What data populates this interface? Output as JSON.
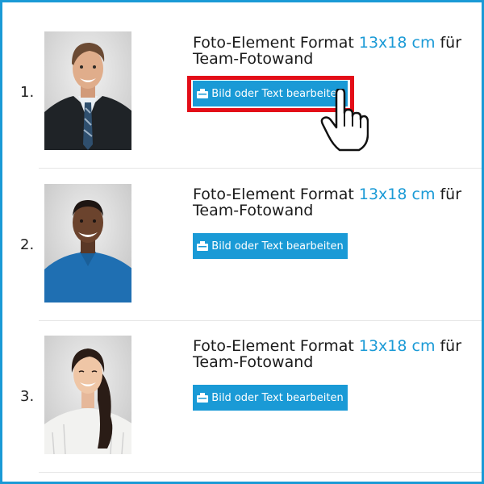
{
  "items": [
    {
      "index": "1.",
      "title_prefix": "Foto-Element Format ",
      "title_size": "13x18 cm",
      "title_suffix": " für",
      "title_line2": "Team-Fotowand",
      "button_label": "Bild oder Text bearbeiten",
      "highlighted": true
    },
    {
      "index": "2.",
      "title_prefix": "Foto-Element Format ",
      "title_size": "13x18 cm",
      "title_suffix": " für",
      "title_line2": "Team-Fotowand",
      "button_label": "Bild oder Text bearbeiten",
      "highlighted": false
    },
    {
      "index": "3.",
      "title_prefix": "Foto-Element Format ",
      "title_size": "13x18 cm",
      "title_suffix": " für",
      "title_line2": "Team-Fotowand",
      "button_label": "Bild oder Text bearbeiten",
      "highlighted": false
    }
  ],
  "icons": {
    "button_icon": "edit-icon",
    "cursor_icon": "hand-pointer-icon"
  },
  "colors": {
    "accent": "#1a9ad6",
    "highlight": "#e30d18"
  }
}
